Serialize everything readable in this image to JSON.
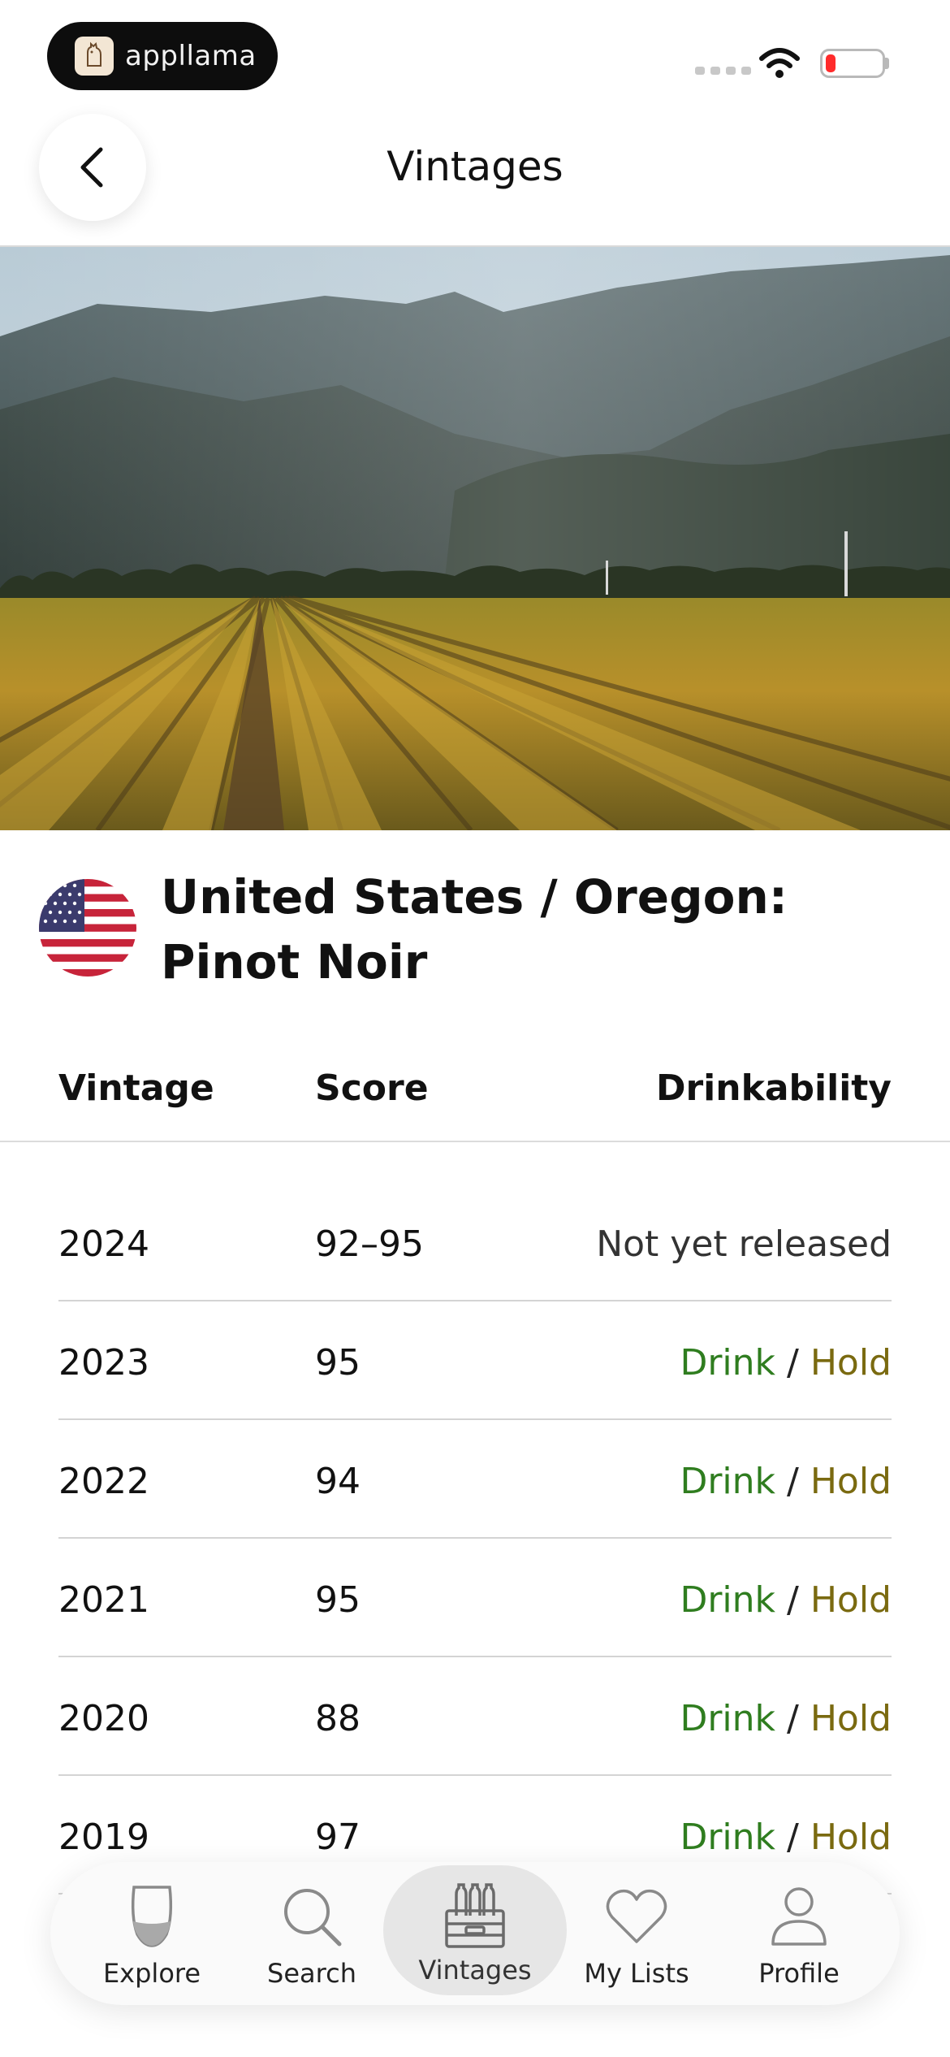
{
  "status_bar": {
    "app_name": "appllama",
    "battery_color": "#ff2b2b"
  },
  "header": {
    "title": "Vintages",
    "back_icon": "chevron-left-icon"
  },
  "region": {
    "flag": "us-flag-icon",
    "title_line1": "United States / Oregon:",
    "title_line2": "Pinot Noir"
  },
  "table": {
    "headers": {
      "vintage": "Vintage",
      "score": "Score",
      "drinkability": "Drinkability"
    },
    "rows": [
      {
        "vintage": "2024",
        "score": "92–95",
        "status": "Not yet released"
      },
      {
        "vintage": "2023",
        "score": "95",
        "drink": "Drink",
        "sep": "/",
        "hold": "Hold"
      },
      {
        "vintage": "2022",
        "score": "94",
        "drink": "Drink",
        "sep": "/",
        "hold": "Hold"
      },
      {
        "vintage": "2021",
        "score": "95",
        "drink": "Drink",
        "sep": "/",
        "hold": "Hold"
      },
      {
        "vintage": "2020",
        "score": "88",
        "drink": "Drink",
        "sep": "/",
        "hold": "Hold"
      },
      {
        "vintage": "2019",
        "score": "97",
        "drink": "Drink",
        "sep": "/",
        "hold": "Hold"
      }
    ],
    "colors": {
      "drink": "#2f7d1f",
      "hold": "#7a6a10"
    }
  },
  "tab_bar": {
    "active": "Vintages",
    "tabs": [
      {
        "label": "Explore",
        "icon": "wine-glass-icon"
      },
      {
        "label": "Search",
        "icon": "search-icon"
      },
      {
        "label": "Vintages",
        "icon": "wine-crate-icon"
      },
      {
        "label": "My Lists",
        "icon": "heart-icon"
      },
      {
        "label": "Profile",
        "icon": "person-icon"
      }
    ]
  }
}
